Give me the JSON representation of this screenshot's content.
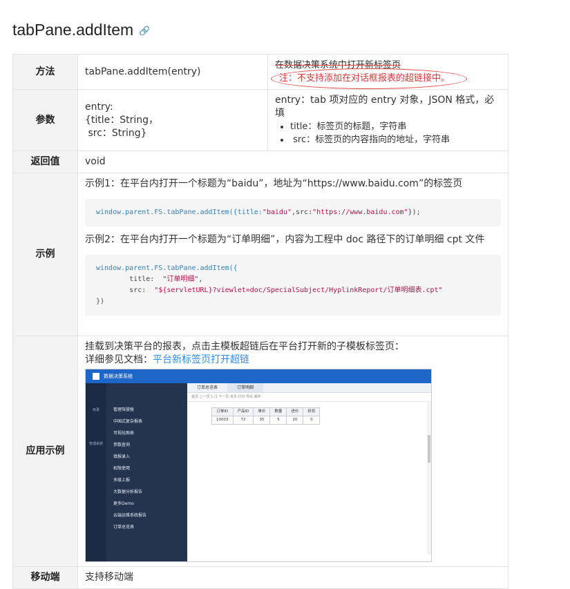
{
  "title": "tabPane.addItem",
  "link_icon": "link-icon",
  "rows": {
    "method": {
      "label": "方法",
      "signature": "tabPane.addItem(entry)",
      "desc": "在数据决策系统中打开新标签页",
      "note": "注：不支持添加在对话框报表的超链接中。"
    },
    "params": {
      "label": "参数",
      "entry_line1": "entry:",
      "entry_line2": "{title：String，",
      "entry_line3": " src：String}",
      "desc": "entry：tab 项对应的 entry 对象，JSON 格式，必填",
      "bullets": [
        "title：标签页的标题，字符串",
        " src：标签页的内容指向的地址，字符串"
      ]
    },
    "returns": {
      "label": "返回值",
      "value": "void"
    },
    "examples": {
      "label": "示例",
      "ex1_text": "示例1：在平台内打开一个标题为“baidu”，地址为“https://www.baidu.com”的标签页",
      "ex1_code_prefix": "window.parent.FS.tabPane.addItem({title:",
      "ex1_code_title": "\"baidu\"",
      "ex1_code_mid": ",src:",
      "ex1_code_src": "\"https://www.baidu.com\"",
      "ex1_code_suffix": "});",
      "ex2_text": "示例2：在平台内打开一个标题为“订单明细”，内容为工程中 doc 路径下的订单明细 cpt 文件",
      "ex2_code_line1": "window.parent.FS.tabPane.addItem({",
      "ex2_code_title_key": "        title:  ",
      "ex2_code_title_val": "\"订单明细\"",
      "ex2_code_title_end": ",",
      "ex2_code_src_key": "        src:  ",
      "ex2_code_src_val": "\"${servletURL}?viewlet=doc/SpecialSubject/HyplinkReport/订单明细表.cpt\"",
      "ex2_code_end": "})"
    },
    "usage": {
      "label": "应用示例",
      "text1": "挂载到决策平台的报表，点击主模板超链后在平台打开新的子模板标签页：",
      "text2_prefix": "详细参见文档：",
      "text2_link": "平台新标签页打开超链",
      "shot": {
        "app_title": "数据决策系统",
        "left_items": [
          "目录",
          "管理系统"
        ],
        "tree": [
          "管理驾驶舱",
          "中国式复杂报表",
          "可视化图表",
          "参数查询",
          "填报录入",
          "权限使用",
          "多级上报",
          "大数据分析报告",
          "更多Demo",
          "云端运维系统报告",
          "订单总览表"
        ],
        "tabs": [
          "订单总览表",
          "订单明细"
        ],
        "tools": "首页  上一页  1  /1  下一页  末页  打印  导出  邮件",
        "grid_headers": [
          "订单ID",
          "产品ID",
          "单价",
          "数量",
          "进价",
          "折扣"
        ],
        "grid_row": [
          "10003",
          "72",
          "35",
          "5",
          "20",
          "0"
        ]
      }
    },
    "mobile": {
      "label": "移动端",
      "value": "支持移动端"
    }
  }
}
